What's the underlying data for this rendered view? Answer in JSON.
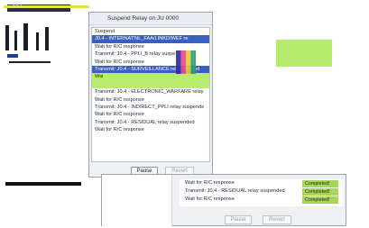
{
  "top_strip": {
    "label": "NU"
  },
  "dialog": {
    "title": "Suspend Relay on JU 0000",
    "log_lines": [
      {
        "text": "Suspend",
        "style": "plain"
      },
      {
        "text": "J0.4 - INTERNAT'NL_FAA/LINKD/WEF re",
        "style": "blue"
      },
      {
        "text": "Wait for R/C response",
        "style": "plain"
      },
      {
        "text": "Transmit: J0.4 - PPLI_B relay suspe",
        "style": "plain"
      },
      {
        "text": "Wait for R/C response",
        "style": "plain"
      },
      {
        "text": "Transmit: J0.4 - SURVEILLANCE relay deleted",
        "style": "blue"
      },
      {
        "text": "Wai",
        "style": "green"
      },
      {
        "text": "",
        "style": "green"
      },
      {
        "text": "Transmit: J0.4 - ELECTRONIC_WARFARE relay",
        "style": "plain"
      },
      {
        "text": "Wait for R/C response",
        "style": "plain"
      },
      {
        "text": "Transmit: J0.4 - INDIRECT_PPLI relay suspende",
        "style": "plain"
      },
      {
        "text": "Wait for R/C response",
        "style": "plain"
      },
      {
        "text": "Transmit: J0.4 - RESIDUAL relay suspended",
        "style": "plain"
      },
      {
        "text": "Wait for R/C response",
        "style": "plain"
      },
      {
        "text": "",
        "style": "plain"
      },
      {
        "text": "",
        "style": "plain"
      },
      {
        "text": "",
        "style": "plain"
      }
    ],
    "pause_label": "Pause",
    "revert_label": "Revert"
  },
  "bottom_dialog": {
    "rows": [
      {
        "text": "Wait for R/C response",
        "status": "Completed!"
      },
      {
        "text": "Transmit: J0.4 - RESIDUAL relay suspended",
        "status": "Completed!"
      },
      {
        "text": "Wait for R/C response",
        "status": "Completed!"
      }
    ],
    "pause_label": "Pause",
    "revert_label": "Revert"
  }
}
